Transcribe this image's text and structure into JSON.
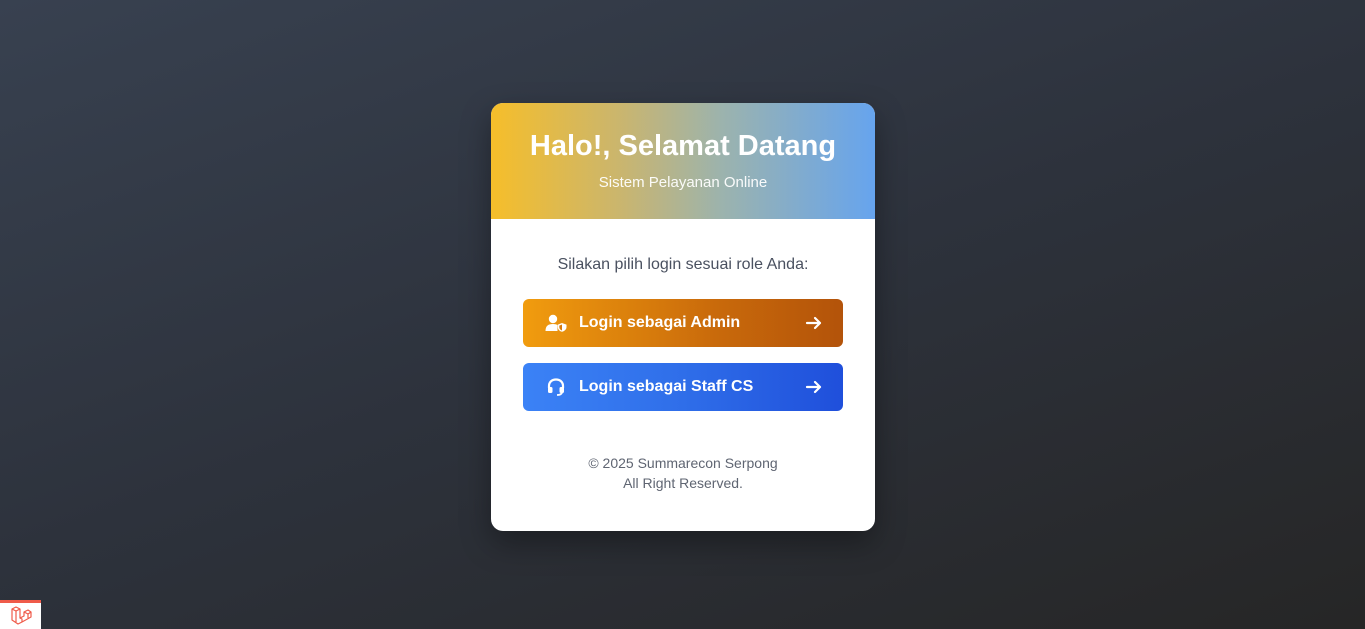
{
  "header": {
    "title": "Halo!, Selamat Datang",
    "subtitle": "Sistem Pelayanan Online"
  },
  "body": {
    "prompt": "Silakan pilih login sesuai role Anda:"
  },
  "buttons": {
    "admin": {
      "label": "Login sebagai Admin",
      "icon": "user-shield-icon"
    },
    "cs": {
      "label": "Login sebagai Staff CS",
      "icon": "headset-icon"
    }
  },
  "footer": {
    "copyright": "© 2025 Summarecon Serpong",
    "rights": "All Right Reserved."
  },
  "corner": {
    "icon": "laravel-logo-icon"
  },
  "colors": {
    "admin_button": "#f19c0e",
    "cs_button": "#3b82f6",
    "header_left": "#f6be2a",
    "header_right": "#66a4ee"
  }
}
